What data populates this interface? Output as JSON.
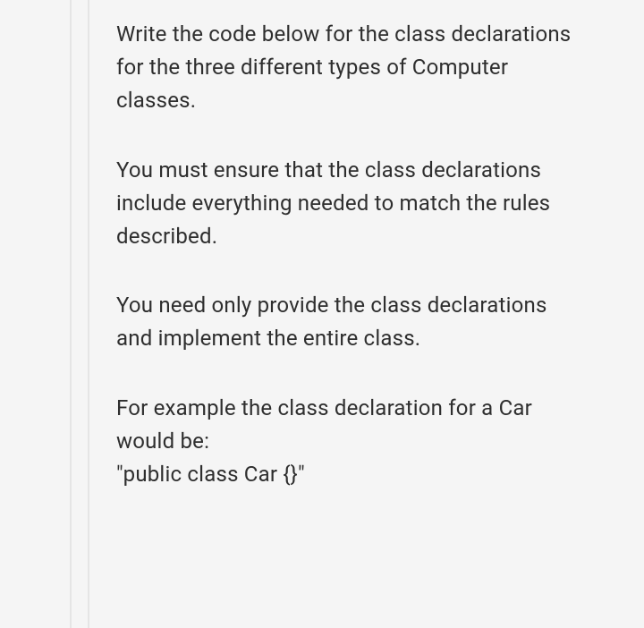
{
  "paragraphs": {
    "p1": "Write the code below for the class declarations for the three different types of Computer classes.",
    "p2": "You must ensure that the class declarations include everything needed to match the rules described.",
    "p3": "You need only provide the class declarations and implement the entire class.",
    "p4": "For example the class declaration for a Car would be:\n\"public class Car {}\""
  }
}
